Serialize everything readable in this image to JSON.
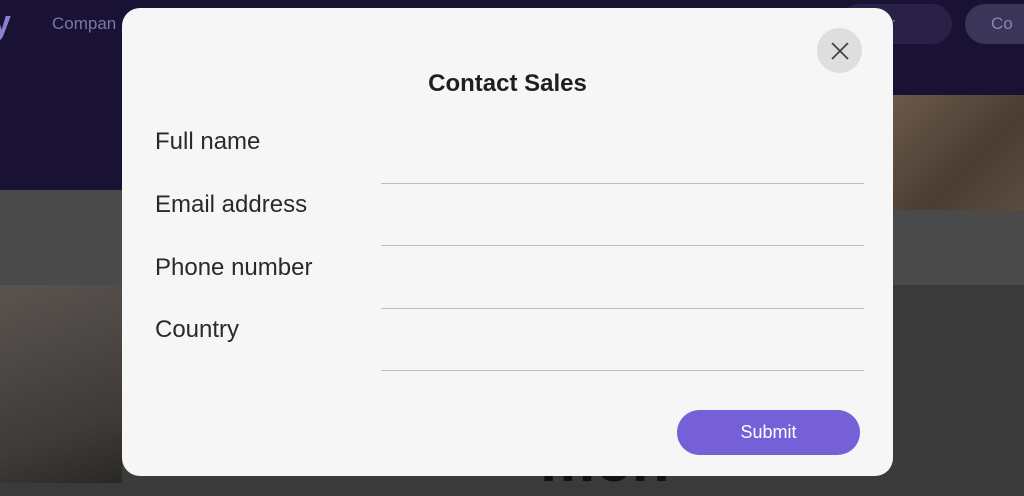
{
  "background": {
    "logo": "y",
    "nav_item": "Compan",
    "pill1_text": "er",
    "pill2_text": "Co",
    "big_text": "men"
  },
  "modal": {
    "title": "Contact Sales",
    "close_icon": "close-icon",
    "fields": [
      {
        "label": "Full name",
        "value": ""
      },
      {
        "label": "Email address",
        "value": ""
      },
      {
        "label": "Phone number",
        "value": ""
      },
      {
        "label": "Country",
        "value": ""
      }
    ],
    "submit_label": "Submit"
  },
  "colors": {
    "accent": "#7660d8",
    "modal_bg": "#f6f6f6",
    "header_bg": "#1a1235"
  }
}
